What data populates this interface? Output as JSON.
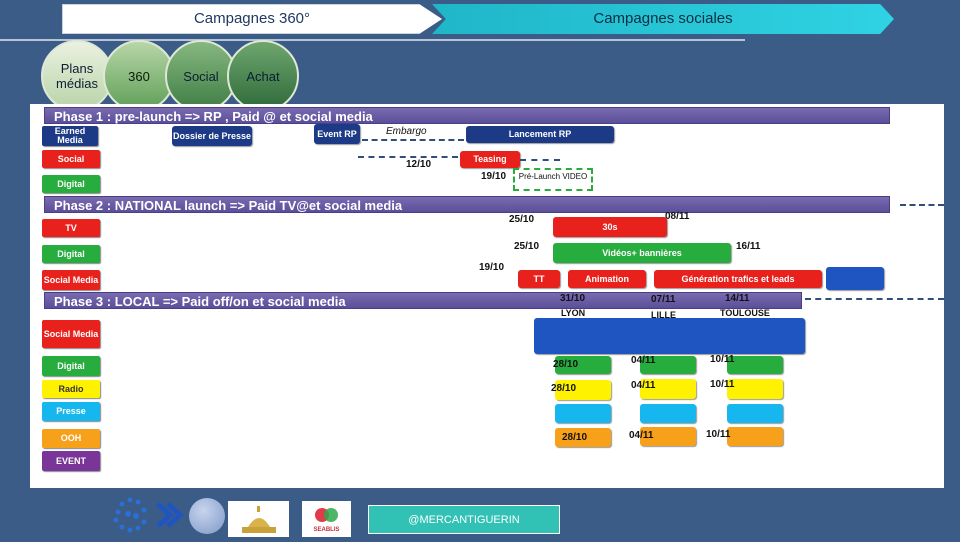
{
  "header": {
    "bar1": "Campagnes 360°",
    "bar2": "Campagnes sociales"
  },
  "circles": [
    {
      "label": "Plans médias"
    },
    {
      "label": "360"
    },
    {
      "label": "Social"
    },
    {
      "label": "Achat"
    }
  ],
  "phases": [
    "Phase 1 : pre-launch => RP , Paid @ et social media",
    "Phase 2 : NATIONAL launch => Paid TV@et social media",
    "Phase 3 : LOCAL => Paid off/on et social media"
  ],
  "channels": {
    "p1": [
      "Earned Media",
      "Social",
      "Digital"
    ],
    "p2": [
      "TV",
      "Digital",
      "Social Media"
    ],
    "p3": [
      "Social Media",
      "Digital",
      "Radio",
      "Presse",
      "OOH",
      "EVENT"
    ]
  },
  "p1": {
    "dossier": "Dossier de Presse",
    "event": "Event RP",
    "embargo": "Embargo",
    "lancement": "Lancement RP",
    "teasing": "Teasing",
    "date_teasing": "12/10",
    "date_prelaunch": "19/10",
    "prelaunch": "Pré-Launch VIDEO"
  },
  "p2": {
    "d1": "25/10",
    "d2": "08/11",
    "tv": "30s",
    "d3": "25/10",
    "videos": "Vidéos+ bannières",
    "d4": "16/11",
    "d5": "19/10",
    "tt": "TT",
    "animation": "Animation",
    "generation": "Génération trafics et leads"
  },
  "p3": {
    "cities": [
      {
        "date": "31/10",
        "name": "LYON"
      },
      {
        "date": "07/11",
        "name": "LILLE"
      },
      {
        "date": "14/11",
        "name": "TOULOUSE"
      }
    ],
    "digital": [
      "28/10",
      "04/11",
      "10/11"
    ],
    "radio": [
      "28/10",
      "04/11",
      "10/11"
    ],
    "ooh": [
      "28/10",
      "04/11",
      "10/11"
    ]
  },
  "footer": {
    "handle": "@MERCANTIGUERIN",
    "logo3": "SEABLIS"
  },
  "colors": {
    "background": "#3b5c86",
    "phase": "#6a5da6",
    "red": "#e8211c",
    "green": "#27ad3d",
    "yellow": "#fff200",
    "cyan": "#16b7ef",
    "orange": "#f7a11a",
    "purple": "#7a3598",
    "blue": "#1f55c0"
  }
}
